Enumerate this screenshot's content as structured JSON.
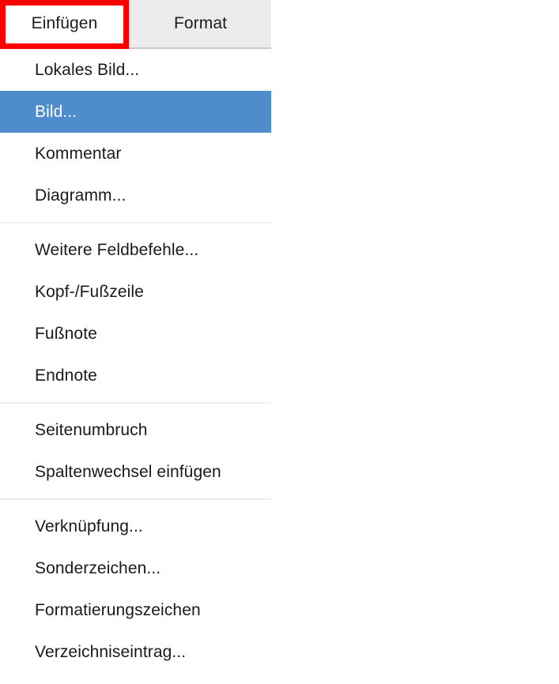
{
  "tabbar": {
    "tabs": [
      {
        "label": "Einfügen",
        "state": "active"
      },
      {
        "label": "Format",
        "state": "inactive"
      }
    ],
    "highlight_color": "#fb0000",
    "inactive_tab_color": "#ececec"
  },
  "menu": {
    "selected_item": "Bild...",
    "selection_color": "#4f8ccb",
    "separator_color": "#efefef",
    "groups": [
      {
        "items": [
          {
            "label": "Lokales Bild...",
            "selected": false
          },
          {
            "label": "Bild...",
            "selected": true
          },
          {
            "label": "Kommentar",
            "selected": false
          },
          {
            "label": "Diagramm...",
            "selected": false
          }
        ]
      },
      {
        "items": [
          {
            "label": "Weitere Feldbefehle...",
            "selected": false
          },
          {
            "label": "Kopf-/Fußzeile",
            "selected": false
          },
          {
            "label": "Fußnote",
            "selected": false
          },
          {
            "label": "Endnote",
            "selected": false
          }
        ]
      },
      {
        "items": [
          {
            "label": "Seitenumbruch",
            "selected": false
          },
          {
            "label": "Spaltenwechsel einfügen",
            "selected": false
          }
        ]
      },
      {
        "items": [
          {
            "label": "Verknüpfung...",
            "selected": false
          },
          {
            "label": "Sonderzeichen...",
            "selected": false
          },
          {
            "label": "Formatierungszeichen",
            "selected": false
          },
          {
            "label": "Verzeichniseintrag...",
            "selected": false
          }
        ]
      }
    ]
  }
}
